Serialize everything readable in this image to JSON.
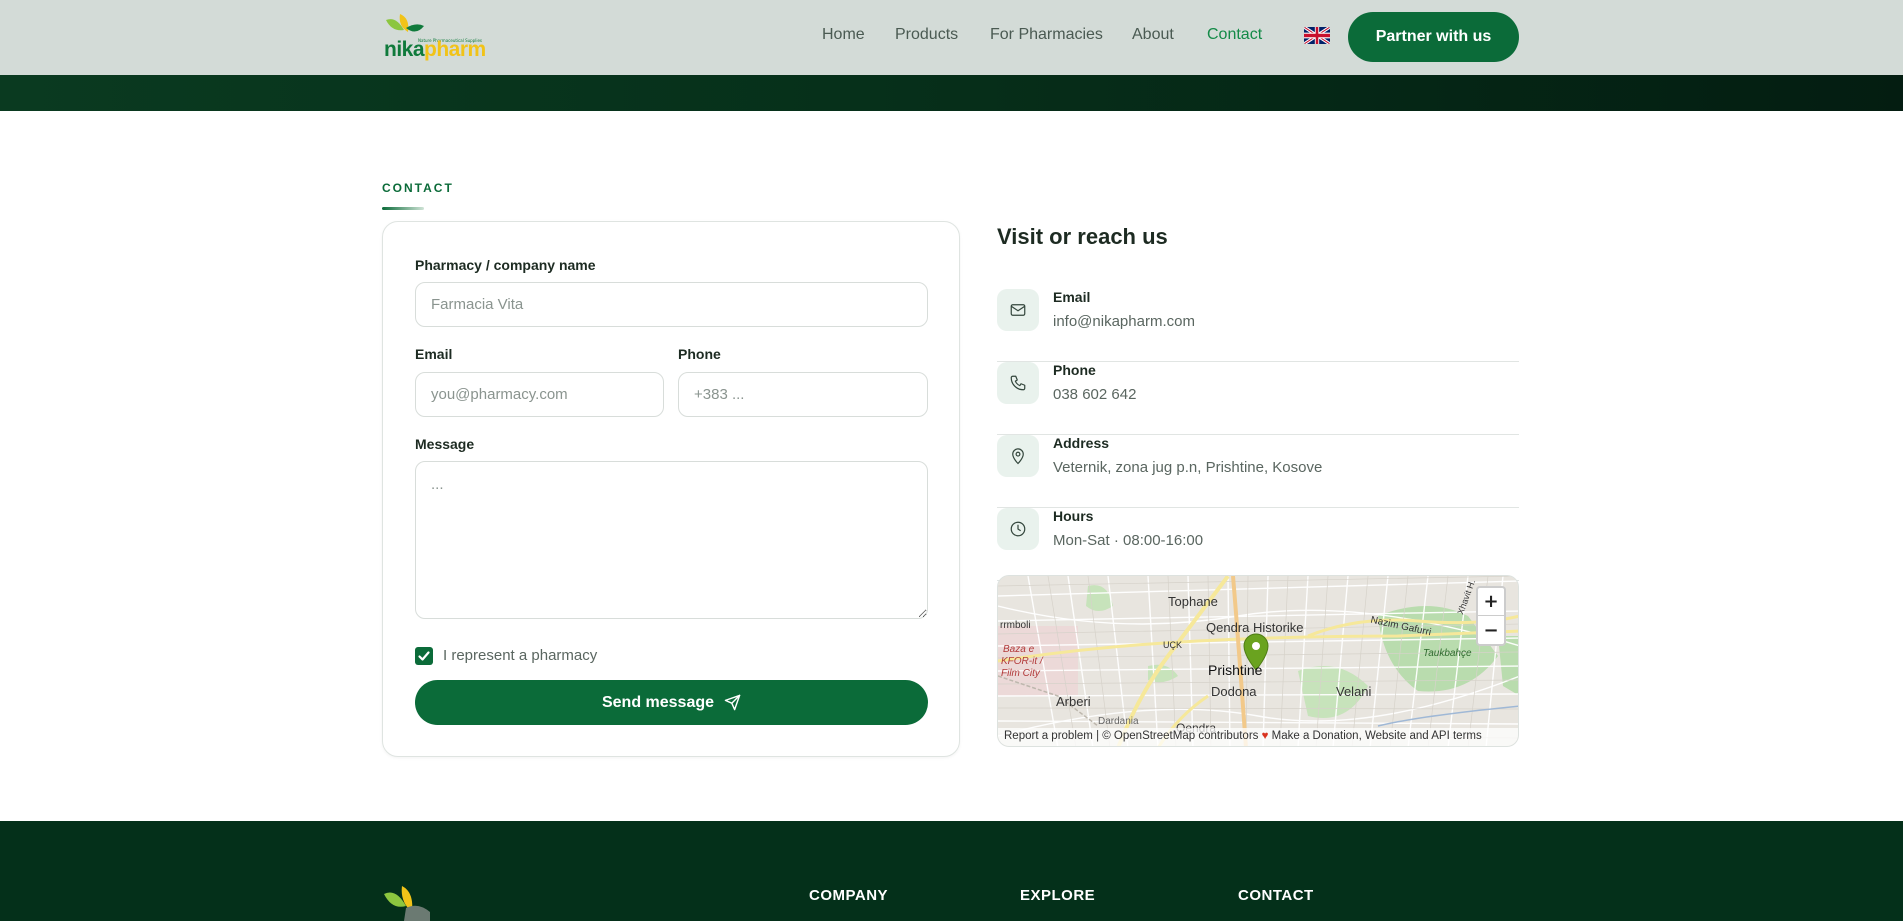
{
  "header": {
    "logo": {
      "part1": "nika",
      "part2": "pharm",
      "tagline": "Nature Pharmaceutical Supplies"
    },
    "nav": [
      {
        "label": "Home"
      },
      {
        "label": "Products"
      },
      {
        "label": "For Pharmacies"
      },
      {
        "label": "About"
      },
      {
        "label": "Contact",
        "active": true
      }
    ],
    "language_icon": "uk-flag-icon",
    "partner_label": "Partner with us",
    "colors": {
      "header_bg": "#d3dbd7",
      "brand_green": "#0b6b39",
      "brand_yellow": "#f1c318"
    }
  },
  "contact": {
    "eyebrow": "CONTACT",
    "form": {
      "company_label": "Pharmacy / company name",
      "company_placeholder": "Farmacia Vita",
      "email_label": "Email",
      "email_placeholder": "you@pharmacy.com",
      "phone_label": "Phone",
      "phone_placeholder": "+383 ...",
      "message_label": "Message",
      "message_placeholder": "...",
      "checkbox_label": "I represent a pharmacy",
      "checkbox_checked": true,
      "send_label": "Send message",
      "send_icon": "send-icon"
    },
    "info": {
      "title": "Visit or reach us",
      "items": [
        {
          "icon": "mail-icon",
          "label": "Email",
          "value": "info@nikapharm.com"
        },
        {
          "icon": "phone-icon",
          "label": "Phone",
          "value": "038 602 642"
        },
        {
          "icon": "location-pin-icon",
          "label": "Address",
          "value": "Veternik, zona jug p.n, Prishtine, Kosove"
        },
        {
          "icon": "clock-icon",
          "label": "Hours",
          "value": "Mon-Sat · 08:00-16:00"
        }
      ]
    },
    "map": {
      "zoom_in": "+",
      "zoom_out": "−",
      "attribution_report": "Report a problem",
      "attribution_separator": "|",
      "attribution_osm": "© OpenStreetMap contributors",
      "attribution_donate": "Make a Donation",
      "attribution_terms": "Website and API terms",
      "labels": {
        "tophane": "Tophane",
        "qendra_historike": "Qendra Historike",
        "prishtine": "Prishtine",
        "dodona": "Dodona",
        "velani": "Velani",
        "arberi": "Arberi",
        "qendra": "Qendra",
        "baza": "Baza e",
        "kfor": "KFOR-it /",
        "film_city": "Film City",
        "taukbahce": "Taukbahçe",
        "uck": "UÇK",
        "nazim_gafurri": "Nazim Gafurri",
        "rrmboli": "rrmboli",
        "dardania": "Dardania",
        "xhavit": "Xhavit H."
      }
    }
  },
  "footer": {
    "headings": {
      "company": "COMPANY",
      "explore": "EXPLORE",
      "contact": "CONTACT"
    }
  }
}
